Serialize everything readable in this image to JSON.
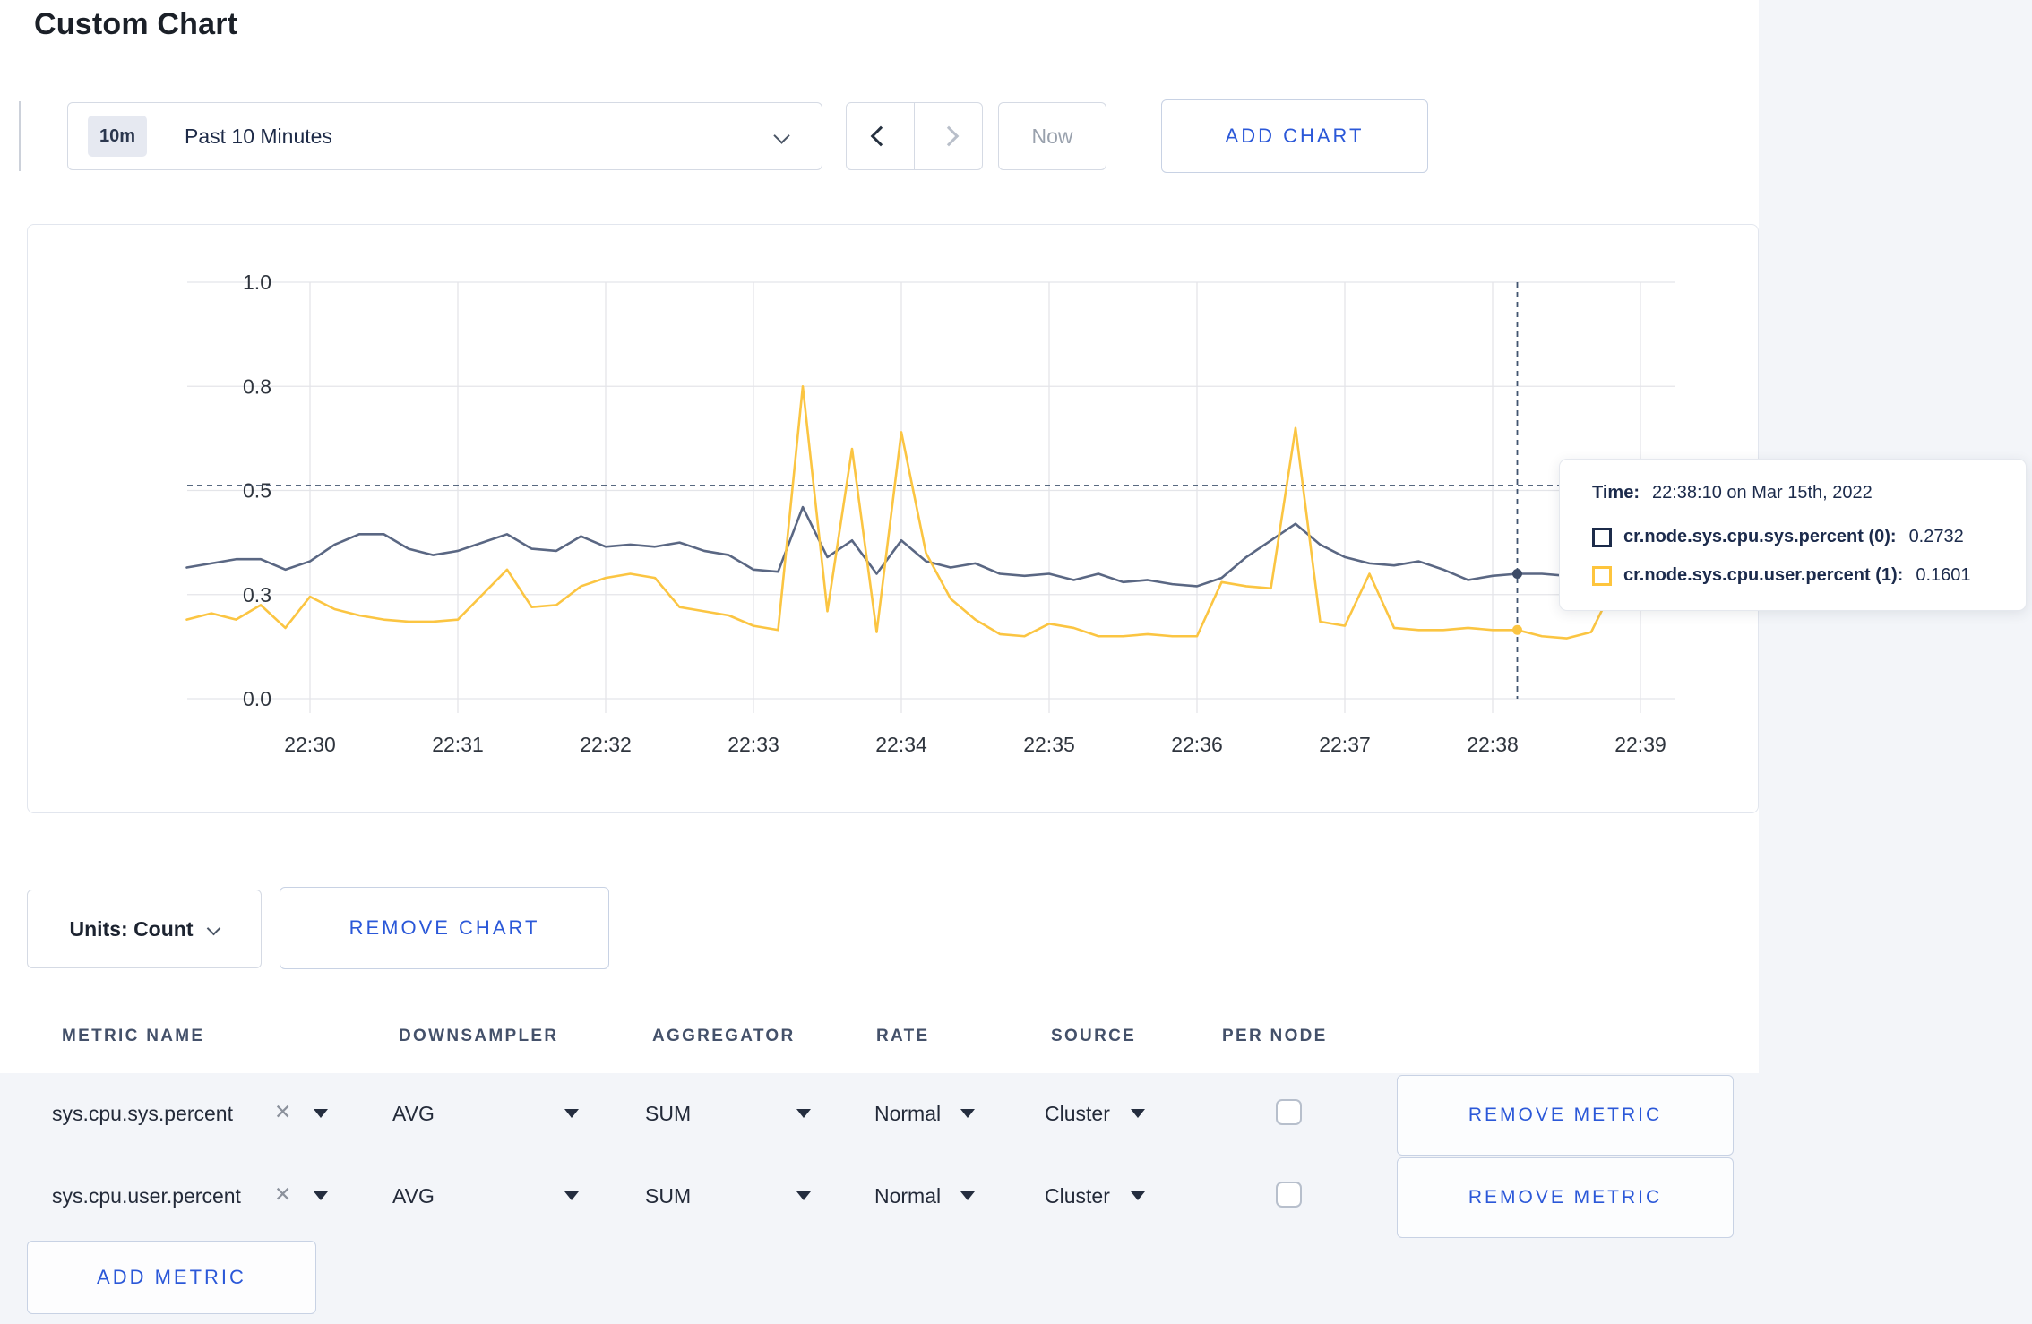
{
  "page": {
    "title": "Custom Chart"
  },
  "toolbar": {
    "time_badge": "10m",
    "time_label": "Past 10 Minutes",
    "now_label": "Now",
    "add_chart_label": "ADD CHART"
  },
  "units_bar": {
    "units_label": "Units: Count",
    "remove_chart_label": "REMOVE CHART"
  },
  "metrics_table": {
    "columns": [
      "METRIC NAME",
      "DOWNSAMPLER",
      "AGGREGATOR",
      "RATE",
      "SOURCE",
      "PER NODE"
    ],
    "rows": [
      {
        "metric": "sys.cpu.sys.percent",
        "downsampler": "AVG",
        "aggregator": "SUM",
        "rate": "Normal",
        "source": "Cluster",
        "per_node_checked": false,
        "remove_label": "REMOVE METRIC"
      },
      {
        "metric": "sys.cpu.user.percent",
        "downsampler": "AVG",
        "aggregator": "SUM",
        "rate": "Normal",
        "source": "Cluster",
        "per_node_checked": false,
        "remove_label": "REMOVE METRIC"
      }
    ],
    "add_metric_label": "ADD METRIC"
  },
  "tooltip": {
    "time_label": "Time:",
    "time_value": "22:38:10 on Mar 15th, 2022",
    "series": [
      {
        "name": "cr.node.sys.cpu.sys.percent (0):",
        "value": "0.2732",
        "swatch_color": "#1c2b4a"
      },
      {
        "name": "cr.node.sys.cpu.user.percent (1):",
        "value": "0.1601",
        "swatch_color": "#fec53d"
      }
    ]
  },
  "chart_data": {
    "type": "line",
    "title": "",
    "xlabel": "",
    "ylabel": "",
    "ylim": [
      0,
      1.0
    ],
    "grid": true,
    "x_start_time": "22:29:10",
    "x_end_time": "22:39:10",
    "x_step_seconds": 10,
    "x_axis_ticks": [
      "22:30",
      "22:31",
      "22:32",
      "22:33",
      "22:34",
      "22:35",
      "22:36",
      "22:37",
      "22:38",
      "22:39"
    ],
    "y_axis_ticks": [
      {
        "value": 0.0,
        "label": "0.0"
      },
      {
        "value": 0.25,
        "label": "0.3"
      },
      {
        "value": 0.5,
        "label": "0.5"
      },
      {
        "value": 0.75,
        "label": "0.8"
      },
      {
        "value": 1.0,
        "label": "1.0"
      }
    ],
    "series": [
      {
        "name": "cr.node.sys.cpu.sys.percent",
        "color": "#5a6783",
        "values": [
          0.315,
          0.325,
          0.335,
          0.335,
          0.31,
          0.33,
          0.37,
          0.395,
          0.395,
          0.36,
          0.345,
          0.355,
          0.375,
          0.395,
          0.36,
          0.355,
          0.39,
          0.365,
          0.37,
          0.365,
          0.375,
          0.355,
          0.345,
          0.31,
          0.305,
          0.46,
          0.34,
          0.38,
          0.3,
          0.38,
          0.33,
          0.315,
          0.325,
          0.3,
          0.295,
          0.3,
          0.285,
          0.3,
          0.28,
          0.285,
          0.275,
          0.27,
          0.29,
          0.34,
          0.38,
          0.42,
          0.37,
          0.34,
          0.325,
          0.32,
          0.33,
          0.31,
          0.285,
          0.295,
          0.3,
          0.3,
          0.295,
          0.3,
          0.3,
          0.295,
          0.3
        ]
      },
      {
        "name": "cr.node.sys.cpu.user.percent",
        "color": "#fbc542",
        "values": [
          0.19,
          0.205,
          0.19,
          0.225,
          0.17,
          0.245,
          0.215,
          0.2,
          0.19,
          0.185,
          0.185,
          0.19,
          0.25,
          0.31,
          0.22,
          0.225,
          0.27,
          0.29,
          0.3,
          0.29,
          0.22,
          0.21,
          0.2,
          0.175,
          0.165,
          0.75,
          0.21,
          0.6,
          0.16,
          0.64,
          0.35,
          0.24,
          0.19,
          0.155,
          0.15,
          0.18,
          0.17,
          0.15,
          0.15,
          0.155,
          0.15,
          0.15,
          0.28,
          0.27,
          0.265,
          0.65,
          0.185,
          0.175,
          0.3,
          0.17,
          0.165,
          0.165,
          0.17,
          0.165,
          0.165,
          0.15,
          0.145,
          0.16,
          0.28,
          0.22,
          0.27
        ]
      }
    ],
    "crosshair": {
      "time": "22:38:10",
      "x_seconds": 540,
      "hline_value": 0.512,
      "line_color": "#41546f",
      "points": [
        {
          "series": 0,
          "value": 0.3,
          "dot_color": "#3d4b66"
        },
        {
          "series": 1,
          "value": 0.165,
          "dot_color": "#fbc542"
        }
      ]
    }
  }
}
